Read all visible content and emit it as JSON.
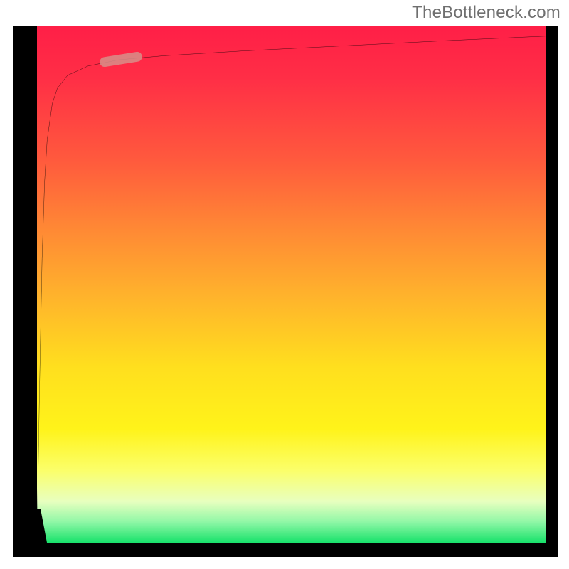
{
  "attribution": "TheBottleneck.com",
  "chart_data": {
    "type": "line",
    "title": "",
    "xlabel": "",
    "ylabel": "",
    "xlim": [
      0,
      100
    ],
    "ylim": [
      0,
      100
    ],
    "background_gradient": {
      "orientation": "vertical",
      "stops": [
        {
          "pos": 0,
          "color": "#ff1f47"
        },
        {
          "pos": 26,
          "color": "#ff5a3d"
        },
        {
          "pos": 52,
          "color": "#ffb22c"
        },
        {
          "pos": 78,
          "color": "#fff31a"
        },
        {
          "pos": 96,
          "color": "#8ff7a6"
        },
        {
          "pos": 100,
          "color": "#18e26b"
        }
      ]
    },
    "series": [
      {
        "name": "curve",
        "stroke": "#000000",
        "x": [
          0,
          0.5,
          1,
          1.5,
          2,
          3,
          4,
          6,
          10,
          16,
          25,
          40,
          60,
          80,
          100
        ],
        "y": [
          0,
          30,
          55,
          70,
          78,
          85,
          88,
          90.5,
          92.3,
          93.5,
          94.3,
          95.2,
          96.2,
          97.2,
          98.1
        ]
      }
    ],
    "marker": {
      "name": "highlight-segment",
      "color": "#d78f8a",
      "approx_center": {
        "x": 16,
        "y": 93.5
      },
      "approx_length_x": 8,
      "shape": "pill"
    }
  }
}
